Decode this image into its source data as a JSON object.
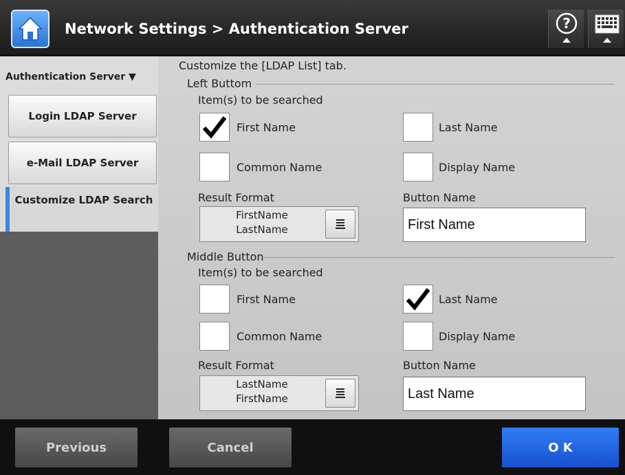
{
  "header": {
    "title": "Network Settings > Authentication Server",
    "home_icon": "home-icon",
    "help_icon": "help-icon",
    "keyboard_icon": "keyboard-icon"
  },
  "sidebar": {
    "heading": "Authentication Server ▼",
    "items": [
      {
        "label": "Login LDAP Server"
      },
      {
        "label": "e-Mail LDAP Server"
      },
      {
        "label": "Customize LDAP Search"
      }
    ],
    "selected_accent": "#3a86e6"
  },
  "main": {
    "instruction": "Customize the [LDAP List] tab.",
    "left_button": {
      "title": "Left Buttom",
      "items_label": "Item(s) to be searched",
      "checkboxes": [
        {
          "label": "First Name",
          "checked": true
        },
        {
          "label": "Last Name",
          "checked": false
        },
        {
          "label": "Common Name",
          "checked": false
        },
        {
          "label": "Display Name",
          "checked": false
        }
      ],
      "result_format_label": "Result Format",
      "result_format_line1": "FirstName",
      "result_format_line2": "LastName",
      "button_name_label": "Button Name",
      "button_name_value": "First Name"
    },
    "middle_button": {
      "title": "Middle Button",
      "items_label": "Item(s) to be searched",
      "checkboxes": [
        {
          "label": "First Name",
          "checked": false
        },
        {
          "label": "Last Name",
          "checked": true
        },
        {
          "label": "Common Name",
          "checked": false
        },
        {
          "label": "Display Name",
          "checked": false
        }
      ],
      "result_format_label": "Result Format",
      "result_format_line1": "LastName",
      "result_format_line2": "FirstName",
      "button_name_label": "Button Name",
      "button_name_value": "Last Name"
    }
  },
  "footer": {
    "previous": "Previous",
    "cancel": "Cancel",
    "ok": "O K"
  }
}
